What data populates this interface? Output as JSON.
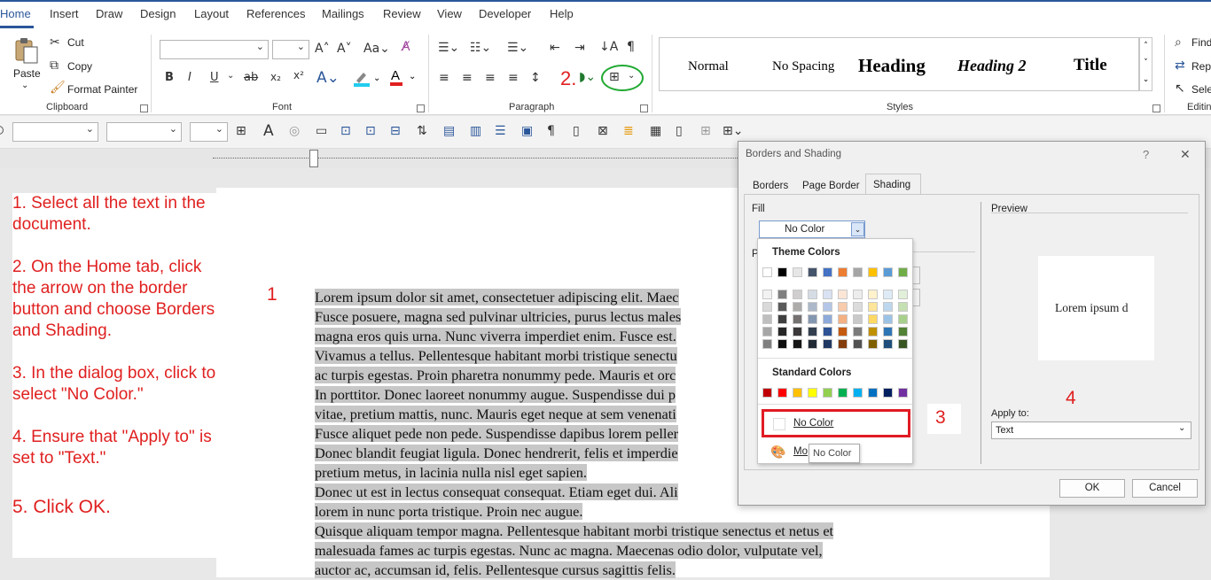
{
  "ribbon": {
    "tabs": [
      "Home",
      "Insert",
      "Draw",
      "Design",
      "Layout",
      "References",
      "Mailings",
      "Review",
      "View",
      "Developer",
      "Help"
    ],
    "clipboard": {
      "paste": "Paste",
      "cut": "Cut",
      "copy": "Copy",
      "format_painter": "Format Painter",
      "label": "Clipboard"
    },
    "font": {
      "label": "Font",
      "bold": "B",
      "italic": "I",
      "underline": "U",
      "strike": "ab",
      "sub": "x₂",
      "sup": "x²"
    },
    "paragraph": {
      "label": "Paragraph"
    },
    "styles": {
      "label": "Styles",
      "items": [
        "Normal",
        "No Spacing",
        "Heading",
        "Heading 2",
        "Title"
      ]
    },
    "editing": {
      "label": "Editin",
      "find": "Find",
      "replace": "Repl",
      "select": "Sele"
    }
  },
  "annotations": {
    "step2": "2.",
    "step1": "1",
    "step3": "3",
    "step4": "4"
  },
  "steps": [
    "1. Select all the text in the document.",
    "2. On the Home tab, click the arrow on the border button and choose Borders and Shading.",
    "3. In the dialog box, click to select \"No Color.\"",
    "4. Ensure that \"Apply to\" is set to \"Text.\"",
    "5. Click OK."
  ],
  "document": {
    "lines": [
      {
        "text": "Lorem ipsum dolor sit amet, consectetuer adipiscing elit. Maec",
        "hl": true
      },
      {
        "text": "Fusce posuere, magna sed pulvinar ultricies, purus lectus males",
        "hl": true
      },
      {
        "text": "magna eros quis urna. Nunc viverra imperdiet enim. Fusce est.",
        "hl": true
      },
      {
        "text": "Vivamus a tellus. Pellentesque habitant morbi tristique senectu",
        "hl": true
      },
      {
        "text": "ac turpis egestas. Proin pharetra nonummy pede. Mauris et orc",
        "hl": true
      },
      {
        "text": "In porttitor. Donec laoreet nonummy augue. Suspendisse dui p",
        "hl": true
      },
      {
        "text": "vitae, pretium mattis, nunc. Mauris eget neque at sem venenati",
        "hl": true
      },
      {
        "text": "Fusce aliquet pede non pede. Suspendisse dapibus lorem peller",
        "hl": true
      },
      {
        "text": "Donec blandit feugiat ligula. Donec hendrerit, felis et imperdie",
        "hl": true
      },
      {
        "text": "pretium metus, in lacinia nulla nisl eget sapien.",
        "hl": true
      },
      {
        "text": "Donec ut est in lectus consequat consequat. Etiam eget dui. Ali",
        "hl": true
      },
      {
        "text": "lorem in nunc porta tristique. Proin nec augue.",
        "hl": true
      },
      {
        "text": "Quisque aliquam tempor magna. Pellentesque habitant morbi tristique senectus et netus et",
        "hl": true
      },
      {
        "text": "malesuada fames ac turpis egestas. Nunc ac magna. Maecenas odio dolor, vulputate vel,",
        "hl": true
      },
      {
        "text": "auctor ac, accumsan id, felis. Pellentesque cursus sagittis felis.",
        "hl": true
      }
    ]
  },
  "dialog": {
    "title": "Borders and Shading",
    "help": "?",
    "close": "✕",
    "tabs": [
      "Borders",
      "Page Border",
      "Shading"
    ],
    "fill_label": "Fill",
    "fill_value": "No Color",
    "pattern_label": "Pa",
    "preview_label": "Preview",
    "preview_text": "Lorem ipsum d",
    "apply_to_label": "Apply to:",
    "apply_to_value": "Text",
    "ok": "OK",
    "cancel": "Cancel",
    "dropdown": {
      "theme_title": "Theme Colors",
      "standard_title": "Standard Colors",
      "no_color": "No Color",
      "more": "Mo",
      "tooltip": "No Color"
    }
  },
  "colors": {
    "theme_top": [
      "#ffffff",
      "#000000",
      "#e7e6e6",
      "#44546a",
      "#4472c4",
      "#ed7d31",
      "#a5a5a5",
      "#ffc000",
      "#5b9bd5",
      "#70ad47"
    ],
    "theme_cols": [
      [
        "#f2f2f2",
        "#d9d9d9",
        "#bfbfbf",
        "#a6a6a6",
        "#7f7f7f"
      ],
      [
        "#7f7f7f",
        "#595959",
        "#3f3f3f",
        "#262626",
        "#0d0d0d"
      ],
      [
        "#d0cece",
        "#aeabab",
        "#757171",
        "#3a3838",
        "#171616"
      ],
      [
        "#d6dce4",
        "#adb9ca",
        "#8497b0",
        "#333f4f",
        "#222a35"
      ],
      [
        "#d9e2f3",
        "#b4c6e7",
        "#8eaadb",
        "#2f5496",
        "#1f3864"
      ],
      [
        "#fbe5d5",
        "#f7cbac",
        "#f4b183",
        "#c55a11",
        "#833c0b"
      ],
      [
        "#ededed",
        "#dbdbdb",
        "#c9c9c9",
        "#7b7b7b",
        "#525252"
      ],
      [
        "#fff2cc",
        "#fee599",
        "#ffd965",
        "#bf9000",
        "#7f6000"
      ],
      [
        "#deebf6",
        "#bdd7ee",
        "#9cc3e5",
        "#2e75b5",
        "#1e4e79"
      ],
      [
        "#e2efd9",
        "#c5e0b3",
        "#a8d08d",
        "#538135",
        "#375623"
      ]
    ],
    "standard": [
      "#c00000",
      "#ff0000",
      "#ffc000",
      "#ffff00",
      "#92d050",
      "#00b050",
      "#00b0f0",
      "#0070c0",
      "#002060",
      "#7030a0"
    ],
    "annotation_red": "#e02020",
    "highlight_green": "#22aa33"
  }
}
